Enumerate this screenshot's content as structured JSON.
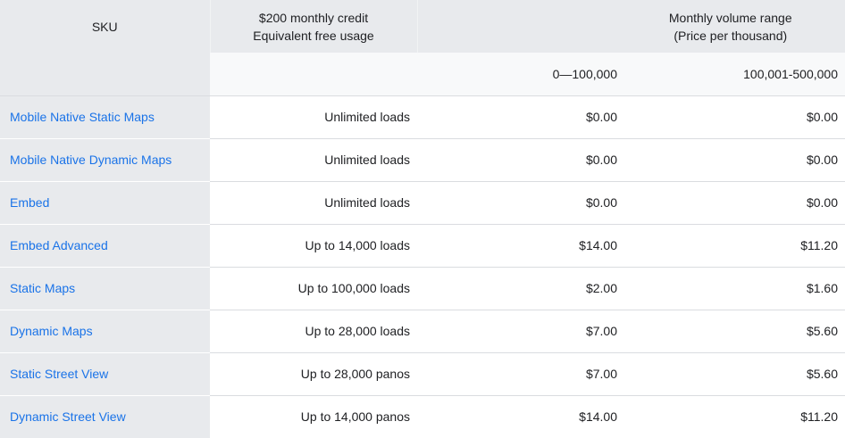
{
  "header": {
    "sku": "SKU",
    "credit_line1": "$200 monthly credit",
    "credit_line2": "Equivalent free usage",
    "volume_line1": "Monthly volume range",
    "volume_line2": "(Price per thousand)",
    "range1": "0—100,000",
    "range2": "100,001-500,000"
  },
  "rows": [
    {
      "sku": "Mobile Native Static Maps",
      "free": "Unlimited loads",
      "price1": "$0.00",
      "price2": "$0.00"
    },
    {
      "sku": "Mobile Native Dynamic Maps",
      "free": "Unlimited loads",
      "price1": "$0.00",
      "price2": "$0.00"
    },
    {
      "sku": "Embed",
      "free": "Unlimited loads",
      "price1": "$0.00",
      "price2": "$0.00"
    },
    {
      "sku": "Embed Advanced",
      "free": "Up to 14,000 loads",
      "price1": "$14.00",
      "price2": "$11.20"
    },
    {
      "sku": "Static Maps",
      "free": "Up to 100,000 loads",
      "price1": "$2.00",
      "price2": "$1.60"
    },
    {
      "sku": "Dynamic Maps",
      "free": "Up to 28,000 loads",
      "price1": "$7.00",
      "price2": "$5.60"
    },
    {
      "sku": "Static Street View",
      "free": "Up to 28,000 panos",
      "price1": "$7.00",
      "price2": "$5.60"
    },
    {
      "sku": "Dynamic Street View",
      "free": "Up to 14,000 panos",
      "price1": "$14.00",
      "price2": "$11.20"
    }
  ],
  "colors": {
    "link": "#1a73e8",
    "header_bg": "#e8eaed",
    "subheader_bg": "#f8f9fa",
    "divider": "#dadce0"
  }
}
